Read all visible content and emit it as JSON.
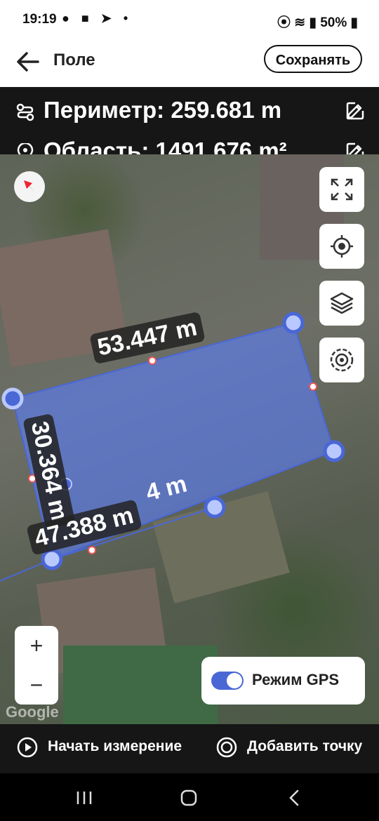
{
  "status": {
    "time": "19:19",
    "battery": "50%"
  },
  "appbar": {
    "title": "Поле",
    "save_label": "Сохранять"
  },
  "stats": {
    "perimeter": "Периметр: 259.681 m",
    "area": "Область: 1491.676 m²"
  },
  "map": {
    "measurements": [
      "53.447 m",
      "30.364 m",
      "47.388 m",
      "4 m"
    ],
    "attribution": "Google",
    "gps_label": "Режим GPS",
    "gps_enabled": true,
    "zoom_in": "+",
    "zoom_out": "−"
  },
  "bottom": {
    "start_label": "Начать измерение",
    "add_label": "Добавить точку"
  },
  "colors": {
    "polygon_fill": "#5b7cf0",
    "polygon_stroke": "#4a67d6",
    "accent": "#4a67d6"
  }
}
